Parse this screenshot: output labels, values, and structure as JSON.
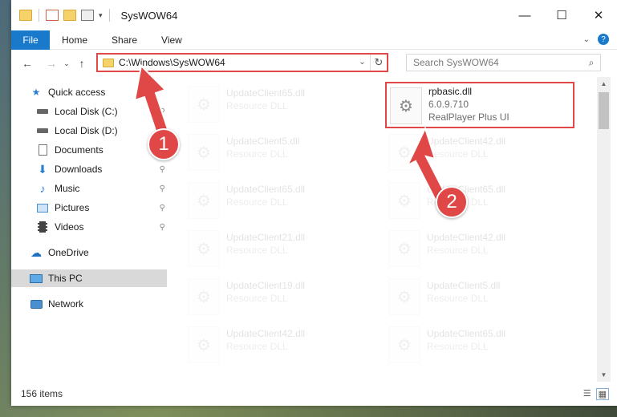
{
  "window": {
    "title": "SysWOW64"
  },
  "ribbon": {
    "tabs": [
      "File",
      "Home",
      "Share",
      "View"
    ]
  },
  "address": {
    "path": "C:\\Windows\\SysWOW64"
  },
  "search": {
    "placeholder": "Search SysWOW64"
  },
  "sidebar": {
    "items": [
      {
        "label": "Quick access",
        "icon": "star-icon",
        "pinned": false
      },
      {
        "label": "Local Disk (C:)",
        "icon": "drive-icon",
        "pinned": true
      },
      {
        "label": "Local Disk (D:)",
        "icon": "drive-icon",
        "pinned": true
      },
      {
        "label": "Documents",
        "icon": "document-icon",
        "pinned": true
      },
      {
        "label": "Downloads",
        "icon": "download-icon",
        "pinned": true
      },
      {
        "label": "Music",
        "icon": "music-icon",
        "pinned": true
      },
      {
        "label": "Pictures",
        "icon": "pictures-icon",
        "pinned": true
      },
      {
        "label": "Videos",
        "icon": "videos-icon",
        "pinned": true
      },
      {
        "label": "OneDrive",
        "icon": "cloud-icon",
        "pinned": false
      },
      {
        "label": "This PC",
        "icon": "computer-icon",
        "pinned": false,
        "selected": true
      },
      {
        "label": "Network",
        "icon": "network-icon",
        "pinned": false
      }
    ]
  },
  "files": {
    "left": [
      {
        "name": "UpdateClient65.dll",
        "type": "Resource DLL"
      },
      {
        "name": "UpdateClient5.dll",
        "type": "Resource DLL"
      },
      {
        "name": "UpdateClient65.dll",
        "type": "Resource DLL"
      },
      {
        "name": "UpdateClient21.dll",
        "type": "Resource DLL"
      },
      {
        "name": "UpdateClient19.dll",
        "type": "Resource DLL"
      },
      {
        "name": "UpdateClient42.dll",
        "type": "Resource DLL"
      }
    ],
    "right": [
      {
        "name": "rpbasic.dll",
        "type": "6.0.9.710",
        "desc": "RealPlayer Plus UI",
        "highlighted": true
      },
      {
        "name": "UpdateClient42.dll",
        "type": "Resource DLL"
      },
      {
        "name": "UpdateClient65.dll",
        "type": "Resource DLL"
      },
      {
        "name": "UpdateClient42.dll",
        "type": "Resource DLL"
      },
      {
        "name": "UpdateClient5.dll",
        "type": "Resource DLL"
      },
      {
        "name": "UpdateClient65.dll",
        "type": "Resource DLL"
      }
    ]
  },
  "status": {
    "count": "156 items"
  },
  "callouts": {
    "one": "1",
    "two": "2"
  },
  "colors": {
    "accent": "#1979ca",
    "highlight": "#e04848"
  }
}
